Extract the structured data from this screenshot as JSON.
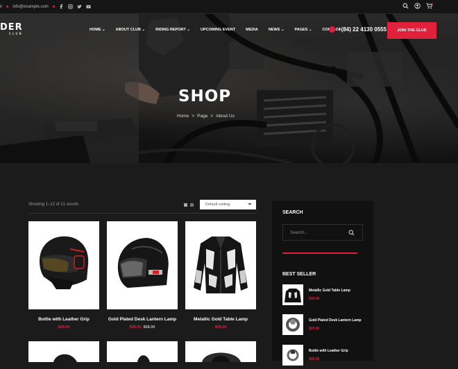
{
  "topbar": {
    "email": "info@example.com",
    "social_icons": [
      "facebook-icon",
      "instagram-icon",
      "twitter-icon",
      "youtube-icon"
    ],
    "right_icons": [
      "search-icon",
      "user-icon",
      "cart-icon"
    ]
  },
  "header": {
    "logo_text": "DER",
    "logo_sub": "CLUB",
    "nav": [
      {
        "label": "HOME",
        "dropdown": true
      },
      {
        "label": "ABOUT CLUB",
        "dropdown": true
      },
      {
        "label": "RIDING REPORT",
        "dropdown": true
      },
      {
        "label": "UPCOMING EVENT",
        "dropdown": false
      },
      {
        "label": "MEDIA",
        "dropdown": false
      },
      {
        "label": "NEWS",
        "dropdown": true
      },
      {
        "label": "PAGES",
        "dropdown": true
      },
      {
        "label": "CONTACT",
        "dropdown": false
      }
    ],
    "phone": "+(84) 22 4130 0555",
    "join_button": "JOIN THE CLUB"
  },
  "hero": {
    "title": "SHOP",
    "breadcrumbs": [
      "Home",
      "Page",
      "About Us"
    ],
    "separator": ">"
  },
  "shop": {
    "showing": "Showing 1–12 of 21 results",
    "sort_selected": "Default sorting",
    "products": [
      {
        "name": "Bottle with Leather Grip",
        "price": "$39.00",
        "old_price": "",
        "image": "motorcycle-helmet-open"
      },
      {
        "name": "Gold Plated Desk Lantern Lamp",
        "price": "$39.00",
        "old_price": "$58.00",
        "image": "motorcycle-helmet-full"
      },
      {
        "name": "Metallic Gold Table Lamp",
        "price": "$39.00",
        "old_price": "",
        "image": "motorcycle-jacket"
      }
    ]
  },
  "sidebar": {
    "search_title": "SEARCH",
    "search_placeholder": "Search...",
    "bestseller_title": "BEST SELLER",
    "bestsellers": [
      {
        "name": "Metallic Gold Table Lamp",
        "price": "$39.00"
      },
      {
        "name": "Gold Plated Desk Lantern Lamp",
        "price": "$39.00"
      },
      {
        "name": "Bottle with Leather Grip",
        "price": "$39.00"
      }
    ]
  },
  "colors": {
    "accent": "#e0213b",
    "background": "#1b1b1b",
    "panel": "#111111"
  }
}
